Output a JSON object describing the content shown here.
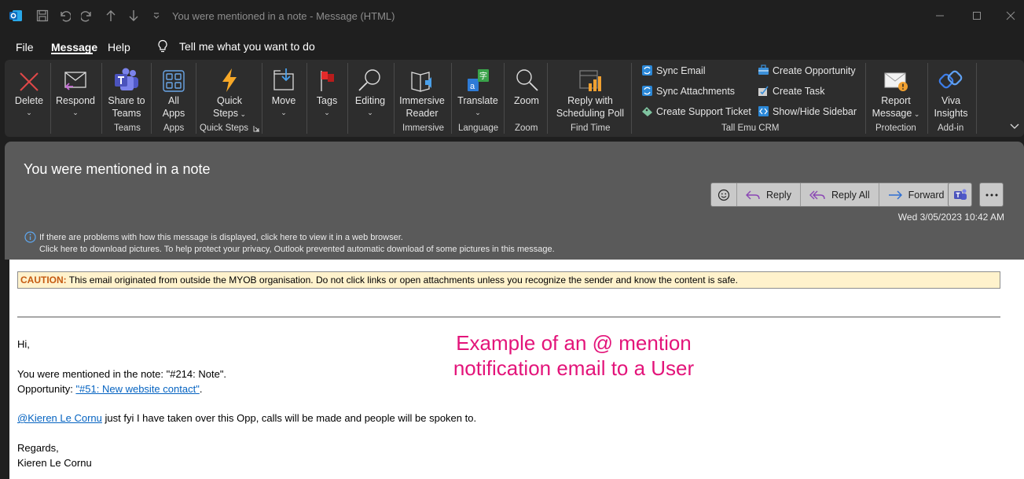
{
  "window": {
    "title": "You were mentioned in a note  -  Message (HTML)"
  },
  "menu": {
    "items": [
      "File",
      "Message",
      "Help"
    ],
    "active": "Message",
    "tell_me": "Tell me what you want to do"
  },
  "ribbon": {
    "delete": "Delete",
    "respond": "Respond",
    "share_to_teams": [
      "Share to",
      "Teams"
    ],
    "all_apps": [
      "All",
      "Apps"
    ],
    "quick_steps": [
      "Quick",
      "Steps"
    ],
    "move": "Move",
    "tags": "Tags",
    "editing": "Editing",
    "immersive_reader": [
      "Immersive",
      "Reader"
    ],
    "translate": "Translate",
    "zoom": "Zoom",
    "reply_with_poll": [
      "Reply with",
      "Scheduling Poll"
    ],
    "crm": {
      "sync_email": "Sync Email",
      "sync_attachments": "Sync Attachments",
      "create_support_ticket": "Create Support Ticket",
      "create_opportunity": "Create Opportunity",
      "create_task": "Create Task",
      "show_hide_sidebar": "Show/Hide Sidebar"
    },
    "report_message": [
      "Report",
      "Message"
    ],
    "viva_insights": [
      "Viva",
      "Insights"
    ],
    "groups": {
      "teams": "Teams",
      "apps": "Apps",
      "quick_steps": "Quick Steps",
      "immersive": "Immersive",
      "language": "Language",
      "zoom": "Zoom",
      "find_time": "Find Time",
      "crm": "Tall Emu CRM",
      "protection": "Protection",
      "addin": "Add-in"
    }
  },
  "message": {
    "subject": "You were mentioned in a note",
    "reply": "Reply",
    "reply_all": "Reply All",
    "forward": "Forward",
    "date": "Wed 3/05/2023 10:42 AM",
    "info_line1": "If there are problems with how this message is displayed, click here to view it in a web browser.",
    "info_line2": "Click here to download pictures. To help protect your privacy, Outlook prevented automatic download of some pictures in this message."
  },
  "body": {
    "caution_label": "CAUTION:",
    "caution_text": " This email originated from outside the MYOB organisation. Do not click links or open attachments unless you recognize the sender and know the content is safe.",
    "greeting": "Hi,",
    "mention_line": "You were mentioned in the note: \"#214: Note\".",
    "opp_prefix": "Opportunity: ",
    "opp_link": "\"#51: New website contact\"",
    "opp_suffix": ".",
    "mention_user": "@Kieren Le Cornu",
    "mention_text": " just fyi I have taken over this Opp, calls will be made and people will be spoken to.",
    "regards": "Regards,",
    "signature": "Kieren Le Cornu"
  },
  "annotation": [
    "Example of an @ mention",
    "notification email to a User"
  ]
}
